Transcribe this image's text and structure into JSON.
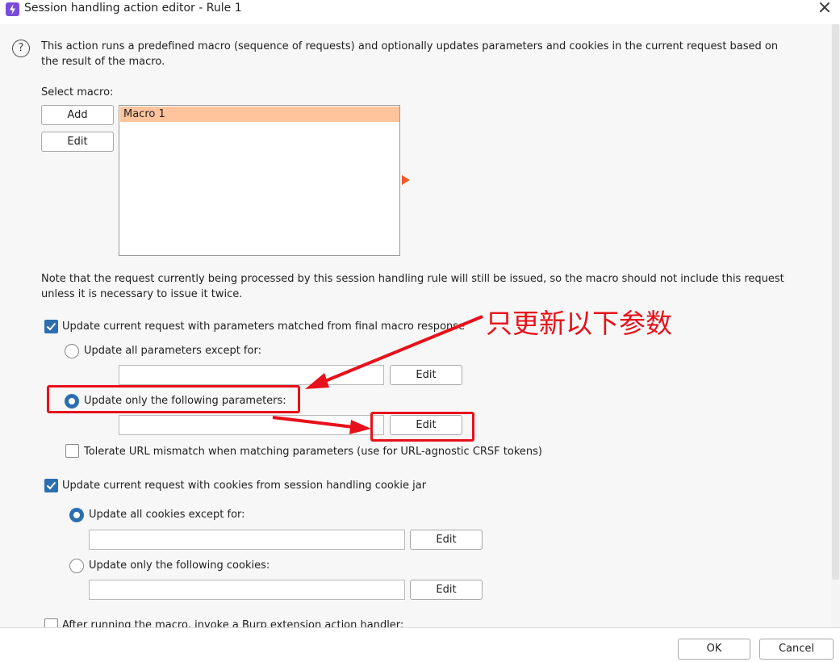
{
  "window": {
    "title": "Session handling action editor - Rule 1"
  },
  "description": "This action runs a predefined macro (sequence of requests) and optionally updates parameters and cookies in the current request based on",
  "description_line2": "the result of the macro.",
  "macro": {
    "label": "Select macro:",
    "add_label": "Add",
    "edit_label": "Edit",
    "items": [
      "Macro 1"
    ]
  },
  "note": {
    "line1": "Note that the request currently being processed by this session handling rule will still be issued, so the macro should not include this request",
    "line2": "unless it is necessary to issue it twice."
  },
  "params": {
    "update_label": "Update current request with parameters matched from final macro response",
    "update_checked": true,
    "all_except_label": "Update all parameters except for:",
    "all_except_edit": "Edit",
    "only_following_label": "Update only the following parameters:",
    "only_following_edit": "Edit",
    "selected_option": "only_following",
    "tolerate_label": "Tolerate URL mismatch when matching parameters (use for URL-agnostic CRSF tokens)",
    "tolerate_checked": false
  },
  "cookies": {
    "update_label": "Update current request with cookies from session handling cookie jar",
    "update_checked": true,
    "all_except_label": "Update all cookies except for:",
    "all_except_edit": "Edit",
    "only_following_label": "Update only the following cookies:",
    "only_following_edit": "Edit",
    "selected_option": "all_except"
  },
  "extension": {
    "label": "After running the macro, invoke a Burp extension action handler:",
    "checked": false
  },
  "footer": {
    "ok_label": "OK",
    "cancel_label": "Cancel"
  },
  "annotation": {
    "text": "只更新以下参数",
    "color": "#e8101a"
  },
  "colors": {
    "accent": "#2b6fb0",
    "selection": "#ffc49c",
    "arrow": "#f05a28"
  }
}
